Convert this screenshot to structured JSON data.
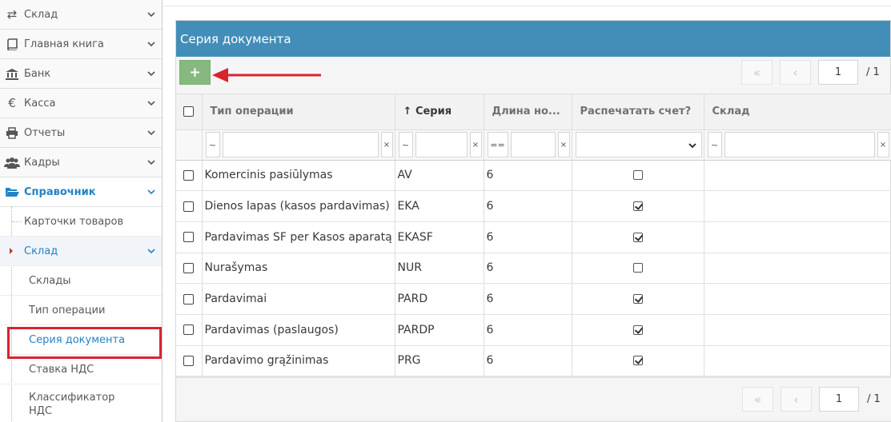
{
  "sidebar": {
    "items": [
      {
        "label": "Склад",
        "icon": "exchange-icon"
      },
      {
        "label": "Главная книга",
        "icon": "book-icon"
      },
      {
        "label": "Банк",
        "icon": "bank-icon"
      },
      {
        "label": "Касса",
        "icon": "euro-icon"
      },
      {
        "label": "Отчеты",
        "icon": "print-icon"
      },
      {
        "label": "Кадры",
        "icon": "users-icon"
      },
      {
        "label": "Справочник",
        "icon": "folder-open-icon"
      }
    ],
    "submenu": [
      {
        "label": "Карточки товаров"
      },
      {
        "label": "Склад"
      }
    ],
    "submenu2": [
      {
        "label": "Склады"
      },
      {
        "label": "Тип операции"
      },
      {
        "label": "Серия документа"
      },
      {
        "label": "Ставка НДС"
      },
      {
        "label": "Классификатор НДС"
      }
    ]
  },
  "panel": {
    "title": "Серия документа",
    "add_label": "+",
    "pager": {
      "first": "«",
      "prev": "‹",
      "page": "1",
      "total": "/ 1"
    }
  },
  "table": {
    "columns": [
      "Тип операции",
      "Серия",
      "Длина но...",
      "Распечатать счет?",
      "Склад"
    ],
    "sort_arrow": "↑",
    "filters": {
      "like": "~",
      "eq": "==",
      "clear": "×"
    },
    "rows": [
      {
        "type": "Komercinis pasiūlymas",
        "series": "AV",
        "length": "6",
        "print": false,
        "warehouse": ""
      },
      {
        "type": "Dienos lapas (kasos pardavimas)",
        "series": "EKA",
        "length": "6",
        "print": true,
        "warehouse": ""
      },
      {
        "type": "Pardavimas SF per Kasos aparatą",
        "series": "EKASF",
        "length": "6",
        "print": true,
        "warehouse": ""
      },
      {
        "type": "Nurašymas",
        "series": "NUR",
        "length": "6",
        "print": false,
        "warehouse": ""
      },
      {
        "type": "Pardavimai",
        "series": "PARD",
        "length": "6",
        "print": true,
        "warehouse": ""
      },
      {
        "type": "Pardavimas (paslaugos)",
        "series": "PARDP",
        "length": "6",
        "print": true,
        "warehouse": ""
      },
      {
        "type": "Pardavimo grąžinimas",
        "series": "PRG",
        "length": "6",
        "print": true,
        "warehouse": ""
      }
    ]
  },
  "colors": {
    "header": "#438eb9",
    "add_button": "#87b87f",
    "accent": "#2283c5",
    "highlight": "#d9232d"
  }
}
